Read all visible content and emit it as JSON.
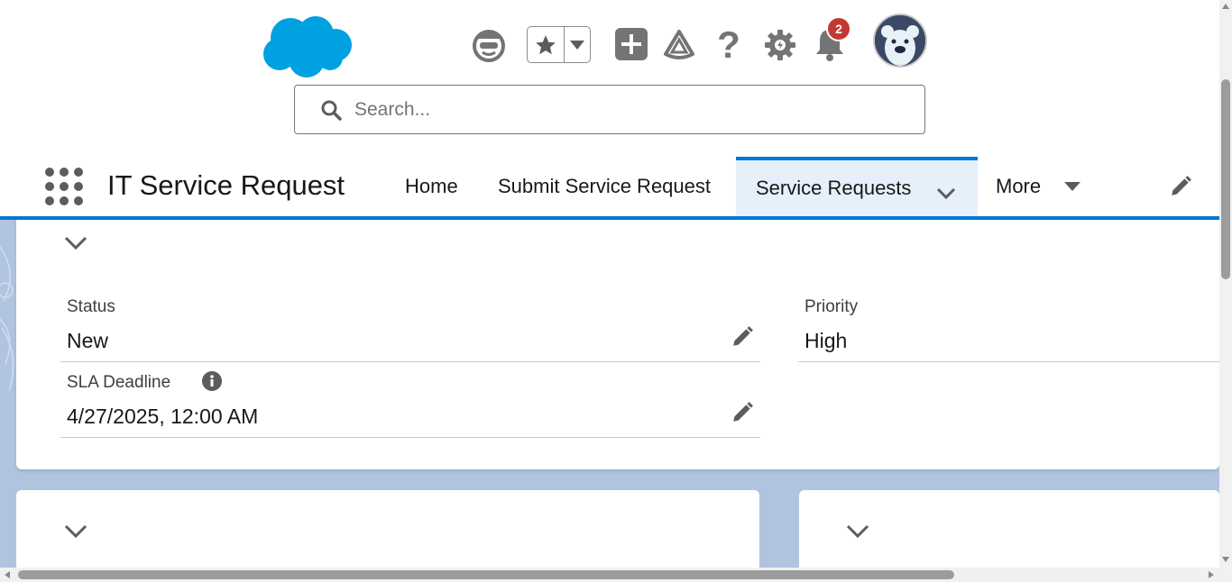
{
  "header": {
    "logo_name": "salesforce-cloud-logo",
    "brand_color": "#00a1e0",
    "search": {
      "placeholder": "Search..."
    },
    "notification_count": "2",
    "icons": [
      "einstein-icon",
      "star-icon",
      "chevron-down-icon",
      "add-icon",
      "trailhead-icon",
      "help-icon",
      "gear-icon",
      "bell-icon",
      "bear-avatar"
    ]
  },
  "nav": {
    "app_name": "IT Service Request",
    "items": [
      {
        "label": "Home"
      },
      {
        "label": "Submit Service Request"
      },
      {
        "label": "Service Requests",
        "active": true
      },
      {
        "label": "More"
      }
    ],
    "accent_color": "#0176d3"
  },
  "record": {
    "fields": [
      {
        "label": "Status",
        "value": "New",
        "editable": true
      },
      {
        "label": "Priority",
        "value": "High",
        "editable": false
      },
      {
        "label": "SLA Deadline",
        "value": "4/27/2025, 12:00 AM",
        "editable": true,
        "has_info": true
      }
    ]
  }
}
